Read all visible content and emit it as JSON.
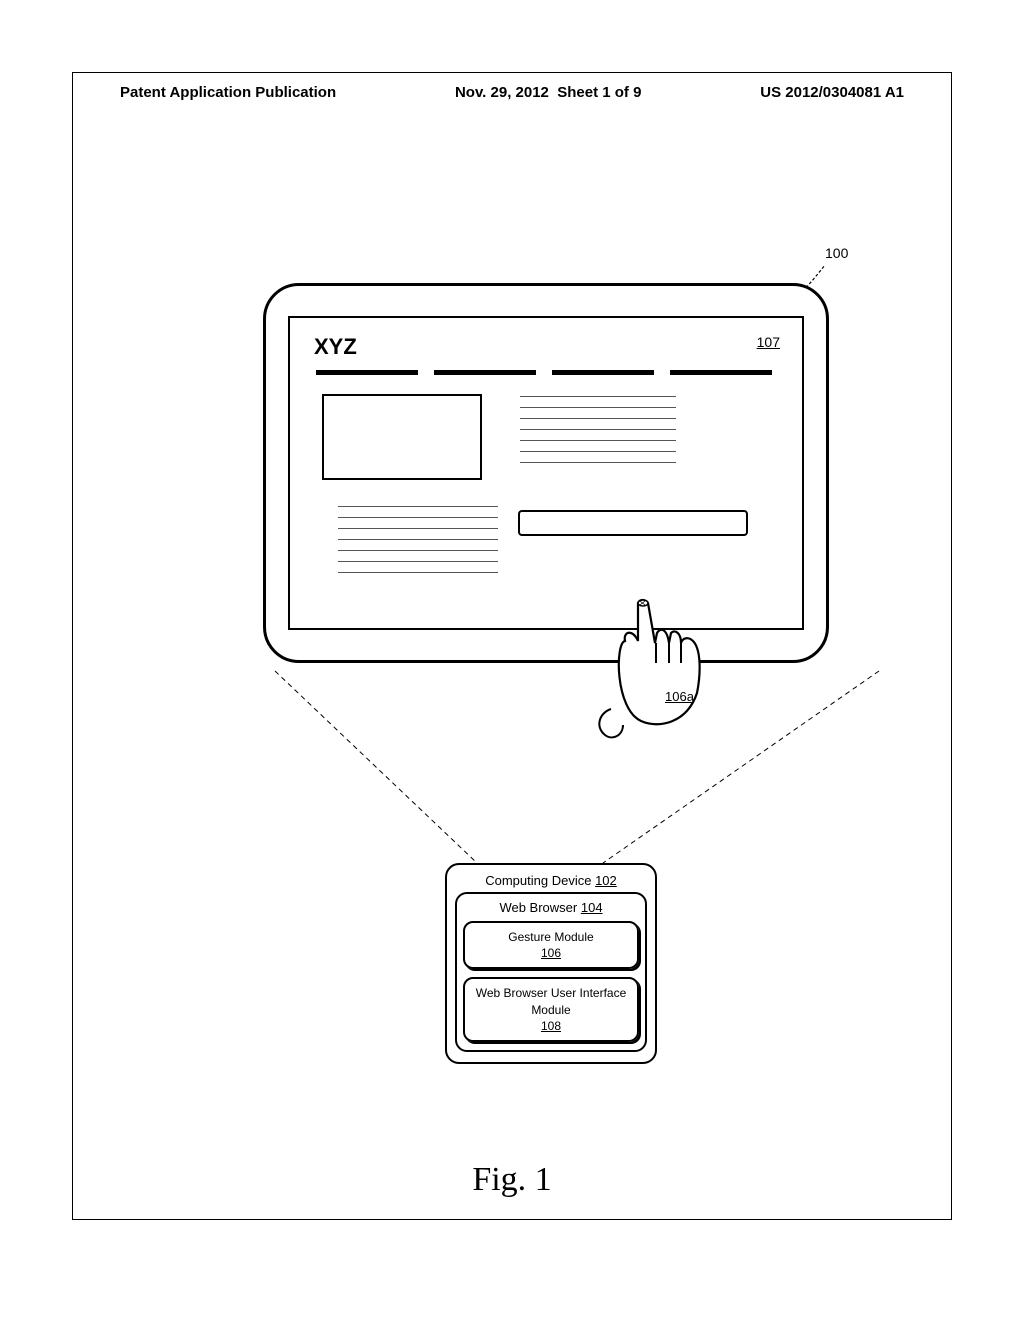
{
  "header": {
    "left": "Patent Application Publication",
    "center": "Nov. 29, 2012  Sheet 1 of 9",
    "right": "US 2012/0304081 A1"
  },
  "refs": {
    "r100": "100",
    "r107": "107",
    "r106a": "106a"
  },
  "webpage": {
    "title": "XYZ"
  },
  "module": {
    "device_label": "Computing Device",
    "device_ref": "102",
    "browser_label": "Web Browser",
    "browser_ref": "104",
    "gesture_label": "Gesture Module",
    "gesture_ref": "106",
    "ui_label": "Web Browser User Interface Module",
    "ui_ref": "108"
  },
  "figure_label": "Fig. 1"
}
